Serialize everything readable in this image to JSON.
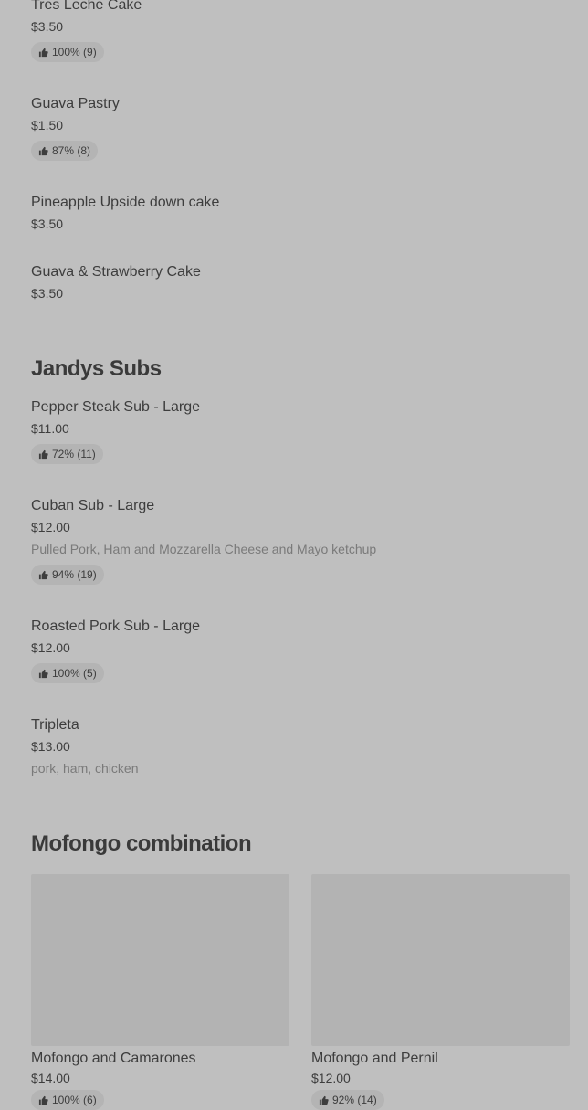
{
  "sections": {
    "desserts": {
      "items": [
        {
          "name": "Tres Leche Cake",
          "price": "$3.50",
          "rating": "100% (9)"
        },
        {
          "name": "Guava Pastry",
          "price": "$1.50",
          "rating": "87% (8)"
        },
        {
          "name": "Pineapple Upside down cake",
          "price": "$3.50"
        },
        {
          "name": "Guava & Strawberry Cake",
          "price": "$3.50"
        }
      ]
    },
    "subs": {
      "title": "Jandys Subs",
      "items": [
        {
          "name": "Pepper Steak Sub - Large",
          "price": "$11.00",
          "rating": "72% (11)"
        },
        {
          "name": "Cuban Sub - Large",
          "price": "$12.00",
          "description": "Pulled Pork, Ham and Mozzarella Cheese and Mayo ketchup",
          "rating": "94% (19)"
        },
        {
          "name": "Roasted Pork Sub - Large",
          "price": "$12.00",
          "rating": "100% (5)"
        },
        {
          "name": "Tripleta",
          "price": "$13.00",
          "description": "pork, ham, chicken"
        }
      ]
    },
    "mofongo": {
      "title": "Mofongo combination",
      "cards": [
        {
          "name": "Mofongo and Camarones",
          "price": "$14.00",
          "rating": "100% (6)"
        },
        {
          "name": "Mofongo and Pernil",
          "price": "$12.00",
          "rating": "92% (14)"
        }
      ]
    }
  },
  "icons": {
    "rating": "thumbs-up-icon"
  },
  "colors": {
    "background": "#bfbfbf",
    "badge": "#b4b4b4",
    "image_placeholder": "#b3b3b3"
  }
}
